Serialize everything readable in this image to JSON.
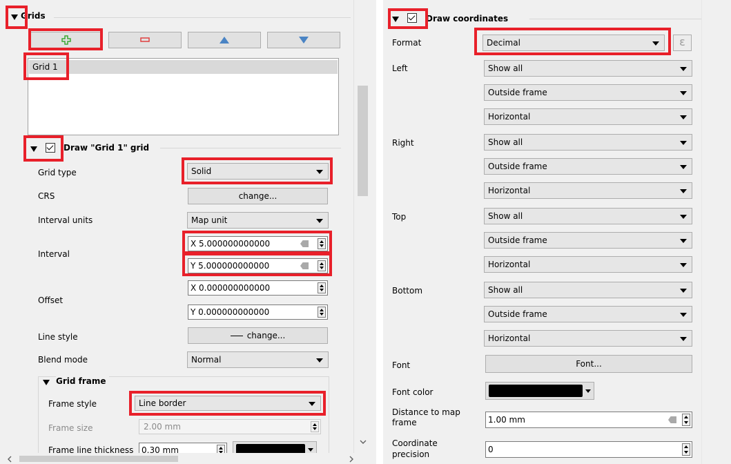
{
  "left": {
    "grids_title": "Grids",
    "grid_list": [
      "Grid 1"
    ],
    "draw_grid_title": "Draw \"Grid 1\" grid",
    "grid_type_label": "Grid type",
    "grid_type_value": "Solid",
    "crs_label": "CRS",
    "crs_button": "change...",
    "interval_units_label": "Interval units",
    "interval_units_value": "Map unit",
    "interval_label": "Interval",
    "interval_x": "X 5.000000000000",
    "interval_y": "Y 5.000000000000",
    "offset_label": "Offset",
    "offset_x": "X 0.000000000000",
    "offset_y": "Y 0.000000000000",
    "line_style_label": "Line style",
    "line_style_button": "change...",
    "blend_mode_label": "Blend mode",
    "blend_mode_value": "Normal",
    "grid_frame_title": "Grid frame",
    "frame_style_label": "Frame style",
    "frame_style_value": "Line border",
    "frame_size_label": "Frame size",
    "frame_size_value": "2.00 mm",
    "frame_thickness_label": "Frame line thickness",
    "frame_thickness_value": "0.30 mm"
  },
  "right": {
    "draw_coords_title": "Draw coordinates",
    "format_label": "Format",
    "format_value": "Decimal",
    "expression_icon": "ε",
    "left_label": "Left",
    "right_label": "Right",
    "top_label": "Top",
    "bottom_label": "Bottom",
    "sides": {
      "left": [
        "Show all",
        "Outside frame",
        "Horizontal"
      ],
      "right": [
        "Show all",
        "Outside frame",
        "Horizontal"
      ],
      "top": [
        "Show all",
        "Outside frame",
        "Horizontal"
      ],
      "bottom": [
        "Show all",
        "Outside frame",
        "Horizontal"
      ]
    },
    "font_label": "Font",
    "font_button": "Font...",
    "font_color_label": "Font color",
    "distance_label_1": "Distance to map",
    "distance_label_2": "frame",
    "distance_value": "1.00 mm",
    "precision_label_1": "Coordinate",
    "precision_label_2": "precision",
    "precision_value": "0"
  },
  "colors": {
    "highlight": "#e8202a",
    "panel": "#f0f0f0",
    "add_icon": "#3aa832",
    "remove_icon": "#e04040",
    "arrow_icon": "#4a84c4"
  }
}
